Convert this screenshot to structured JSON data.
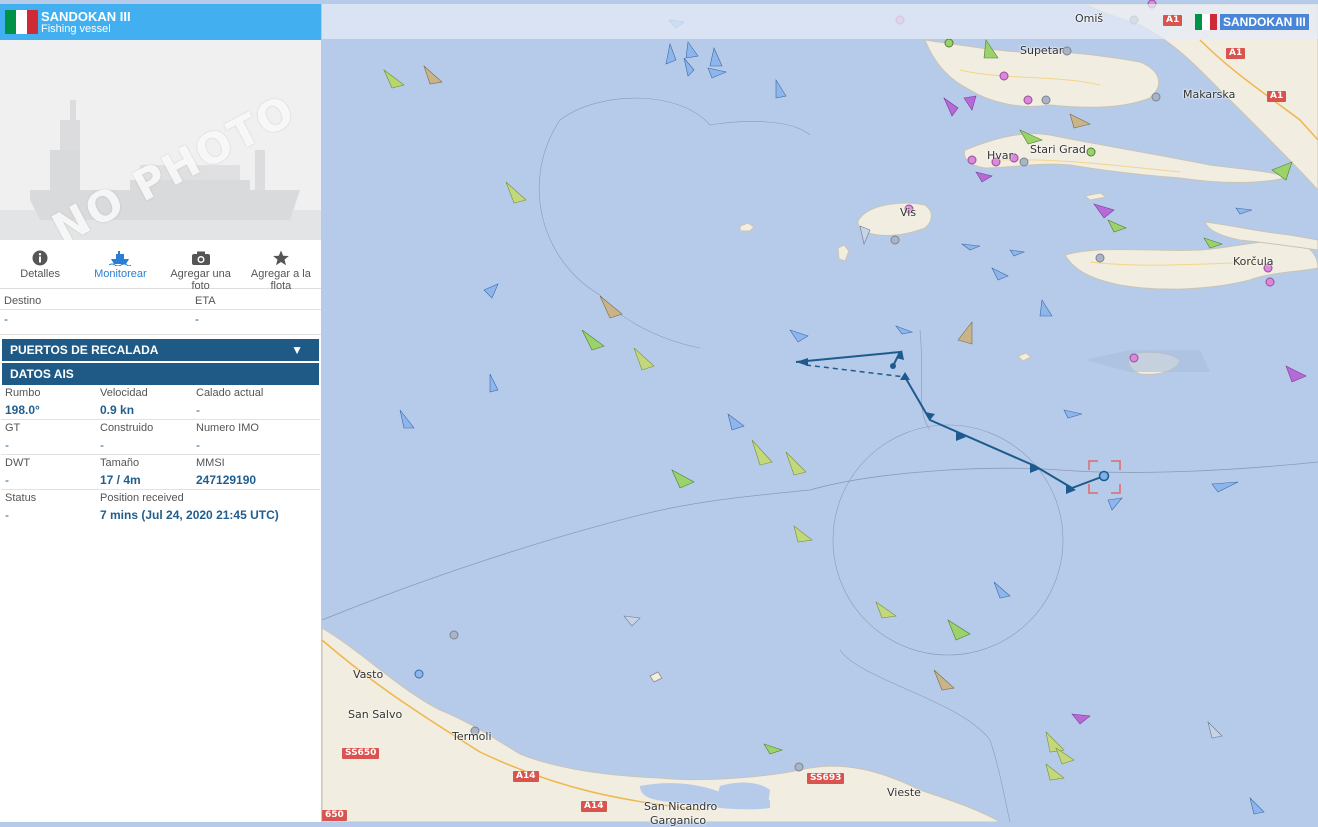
{
  "vessel": {
    "name": "SANDOKAN III",
    "type": "Fishing vessel",
    "photo_placeholder": "NO PHOTO",
    "flag_colors": [
      "#009246",
      "#ffffff",
      "#ce2b37"
    ]
  },
  "actions": [
    {
      "label": "Detalles",
      "icon": "info-icon"
    },
    {
      "label": "Monitorear",
      "icon": "ship-icon",
      "active": true
    },
    {
      "label": "Agregar una foto",
      "icon": "camera-icon"
    },
    {
      "label": "Agregar a la flota",
      "icon": "star-icon"
    }
  ],
  "voyage": {
    "destination_label": "Destino",
    "destination_value": "-",
    "eta_label": "ETA",
    "eta_value": "-"
  },
  "sections": {
    "ports": "PUERTOS DE RECALADA",
    "ais": "DATOS AIS"
  },
  "ais": {
    "course_label": "Rumbo",
    "course_value": "198.0°",
    "speed_label": "Velocidad",
    "speed_value": "0.9 kn",
    "draught_label": "Calado actual",
    "draught_value": "-",
    "gt_label": "GT",
    "gt_value": "-",
    "built_label": "Construido",
    "built_value": "-",
    "imo_label": "Numero IMO",
    "imo_value": "-",
    "dwt_label": "DWT",
    "dwt_value": "-",
    "size_label": "Tamaño",
    "size_value": "17 / 4m",
    "mmsi_label": "MMSI",
    "mmsi_value": "247129190",
    "status_label": "Status",
    "status_value": "-",
    "position_label": "Position received",
    "position_value": "7 mins (Jul 24, 2020 21:45 UTC)"
  },
  "map": {
    "places": [
      "Omiš",
      "Supetar",
      "Makarska",
      "Hvar",
      "Stari Grad",
      "Vis",
      "Korčula",
      "Vasto",
      "San Salvo",
      "Termoli",
      "San Nicandro",
      "Garganico",
      "Vieste"
    ],
    "roads": [
      "A1",
      "A1",
      "A1",
      "A14",
      "A14",
      "SS650",
      "SS693",
      "650"
    ],
    "vessel_tag": "SANDOKAN III",
    "colors": {
      "sea": "#b6cbe9",
      "land": "#f1ede0",
      "track": "#1d5b8f",
      "cargo": "#9bd36a",
      "passenger": "#5d8fd8"
    }
  }
}
